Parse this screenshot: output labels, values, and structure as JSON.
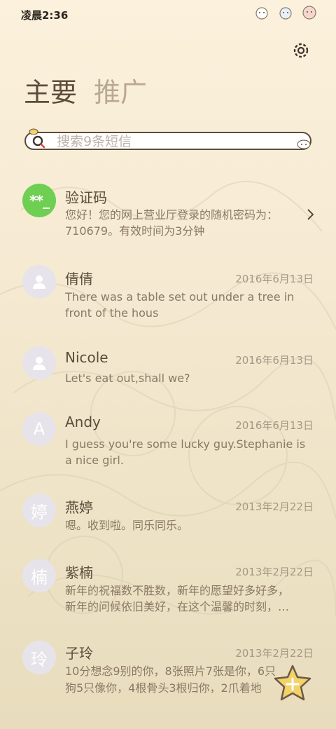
{
  "status": {
    "time": "凌晨2:36"
  },
  "tabs": [
    {
      "label": "主要"
    },
    {
      "label": "推广"
    }
  ],
  "search": {
    "placeholder": "搜索9条短信"
  },
  "messages": [
    {
      "avatar": "**_",
      "name": "验证码",
      "date": "",
      "preview": "您好！您的网上营业厅登录的随机密码为：710679。有效时间为3分钟"
    },
    {
      "avatar": "",
      "name": "倩倩",
      "date": "2016年6月13日",
      "preview": "There was a table set out under a tree in front of the hous"
    },
    {
      "avatar": "",
      "name": "Nicole",
      "date": "2016年6月13日",
      "preview": "Let's eat out,shall we?"
    },
    {
      "avatar": "A",
      "name": "Andy",
      "date": "2016年6月13日",
      "preview": "I guess you're some lucky guy.Stephanie is a nice girl."
    },
    {
      "avatar": "婷",
      "name": "燕婷",
      "date": "2013年2月22日",
      "preview": "嗯。收到啦。同乐同乐。"
    },
    {
      "avatar": "楠",
      "name": "紫楠",
      "date": "2013年2月22日",
      "preview_line1": "新年的祝福数不胜数，新年的愿望好多好多，",
      "preview_line2": "新年的问候依旧美好，在这个温馨的时刻，…"
    },
    {
      "avatar": "玲",
      "name": "子玲",
      "date": "2013年2月22日",
      "preview_line1": "10分想念9别的你，8张照片7张是你，6只",
      "preview_line2": "狗5只像你，4根骨头3根归你，2爪着地"
    }
  ],
  "colors": {
    "accent_green": "#6ecf52",
    "avatar_gray": "#e6e4ea",
    "fab": "#f3d267"
  },
  "icons": [
    "settings-icon",
    "search-icon",
    "chevron-right-icon",
    "person-icon",
    "add-icon"
  ]
}
